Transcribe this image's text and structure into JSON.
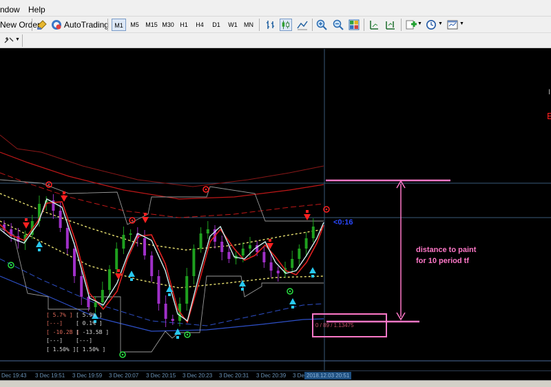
{
  "menu": {
    "window": "ndow",
    "help": "Help"
  },
  "toolbar": {
    "new_order": "New Order",
    "auto_trading": "AutoTrading",
    "timeframes": [
      "M1",
      "M5",
      "M15",
      "M30",
      "H1",
      "H4",
      "D1",
      "W1",
      "MN"
    ],
    "active_timeframe": "M1"
  },
  "chart": {
    "countdown": "<0:16",
    "annotation_line1": "distance to paint",
    "annotation_line2": "for 10 period tf",
    "box_text": "0 / 89 / 1.13475",
    "right_label_1": "I",
    "right_label_2": "E",
    "stats_left": [
      "[ 5.7% ]",
      "[---]",
      "[ -10.2B ]",
      "[---]",
      "[ 1.50% ]"
    ],
    "stats_right": [
      "[ 5.9% ]",
      "[ 0.1% ]",
      "[ -13.5B ]",
      "[---]",
      "[ 1.50% ]"
    ]
  },
  "time_axis": {
    "ticks": [
      "Dec 19:43",
      "3 Dec 19:51",
      "3 Dec 19:59",
      "3 Dec 20:07",
      "3 Dec 20:15",
      "3 Dec 20:23",
      "3 Dec 20:31",
      "3 Dec 20:39",
      "3 Dec"
    ],
    "current_time": "2018.12.03 20:51"
  },
  "colors": {
    "bull_candle": "#1fa01f",
    "bear_candle": "#a030c8",
    "fast_ma": "#e02020",
    "signal_line": "#d0f0f0",
    "upper_band": "#c01818",
    "lower_band": "#2e50c8",
    "mid_band": "#e8e070",
    "annotation": "#ff78c8",
    "countdown": "#2a48ff"
  }
}
